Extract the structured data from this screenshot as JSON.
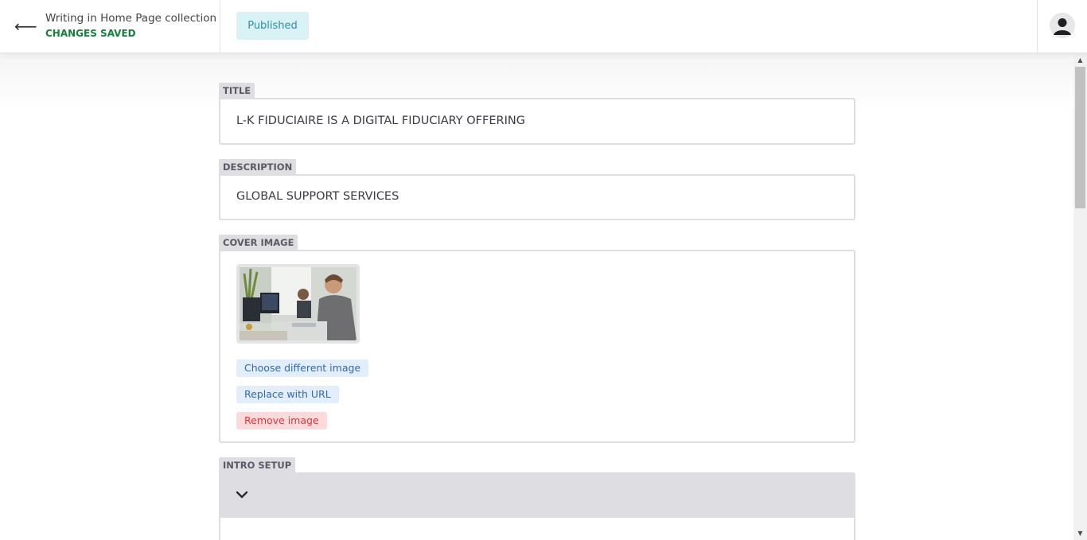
{
  "header": {
    "back_icon": "arrow-left-icon",
    "back_glyph": "⟵",
    "collection_title": "Writing in Home Page collection",
    "save_status": "CHANGES SAVED",
    "status_button": "Published",
    "avatar_icon": "user-avatar-icon"
  },
  "form": {
    "title": {
      "label": "TITLE",
      "value": "L-K FIDUCIAIRE IS A DIGITAL FIDUCIARY OFFERING"
    },
    "description": {
      "label": "DESCRIPTION",
      "value": "GLOBAL SUPPORT SERVICES"
    },
    "cover_image": {
      "label": "COVER IMAGE",
      "choose_label": "Choose different image",
      "replace_label": "Replace with URL",
      "remove_label": "Remove image"
    },
    "intro_setup": {
      "label": "INTRO SETUP",
      "toggle_icon": "chevron-down-icon"
    }
  },
  "colors": {
    "saved_green": "#15803d",
    "published_bg": "#d9f2f5",
    "published_text": "#2a8fa3",
    "label_bg": "#dedee2",
    "chip_blue_bg": "#e2eefb",
    "chip_blue_text": "#3768a8",
    "chip_red_bg": "#fadadb",
    "chip_red_text": "#d33a3e"
  },
  "scrollbar": {
    "up_glyph": "▲",
    "down_glyph": "▼"
  }
}
